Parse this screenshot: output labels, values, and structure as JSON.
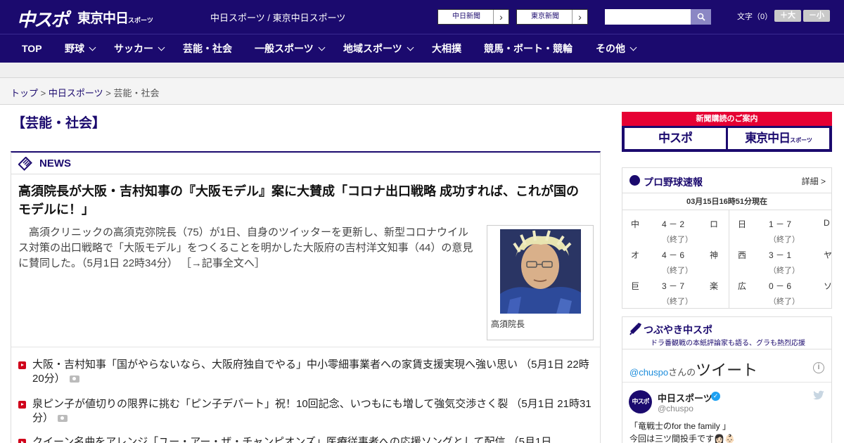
{
  "header": {
    "logo_chuspo": "中スポ",
    "logo_tokyo": "東京中日",
    "logo_tokyo_small": "スポーツ",
    "site_title": "中日スポーツ / 東京中日スポーツ",
    "paper_buttons": [
      "中日新聞",
      "東京新聞"
    ],
    "search": {
      "value": "",
      "placeholder": ""
    },
    "font_label": "文字（0）",
    "font_larger": "＋大",
    "font_smaller": "－小"
  },
  "nav": {
    "items": [
      {
        "label": "TOP",
        "has_menu": false
      },
      {
        "label": "野球",
        "has_menu": true
      },
      {
        "label": "サッカー",
        "has_menu": true
      },
      {
        "label": "芸能・社会",
        "has_menu": false
      },
      {
        "label": "一般スポーツ",
        "has_menu": true
      },
      {
        "label": "地域スポーツ",
        "has_menu": true
      },
      {
        "label": "大相撲",
        "has_menu": false
      },
      {
        "label": "競馬・ボート・競輪",
        "has_menu": false
      },
      {
        "label": "その他",
        "has_menu": true
      }
    ]
  },
  "breadcrumb": {
    "items": [
      "トップ",
      "中日スポーツ",
      "芸能・社会"
    ],
    "separator": ">"
  },
  "page_title": "【芸能・社会】",
  "news": {
    "section_label": "NEWS",
    "headline": "高須院長が大阪・吉村知事の『大阪モデル』案に大賛成「コロナ出口戦略 成功すれば、これが国のモデルに！」",
    "lead": "高須クリニックの高須克弥院長（75）が1日、自身のツイッターを更新し、新型コロナウイルス対策の出口戦略で「大阪モデル」をつくることを明かした大阪府の吉村洋文知事（44）の意見に賛同した。（5月1日 22時34分）",
    "more_link": "［→記事全文へ］",
    "photo_caption": "高須院長",
    "items": [
      "大阪・吉村知事「国がやらないなら、大阪府独自でやる」中小零細事業者への家賃支援実現へ強い思い （5月1日 22時20分）",
      "泉ピン子が値切りの限界に挑む「ピン子デパート」祝！10回記念、いつもにも増して強気交渉さく裂 （5月1日 21時31分）",
      "クイーン名曲をアレンジ「ユー・アー・ザ・チャンピオンズ」医療従事者への応援ソングとして配信 （5月1日"
    ]
  },
  "subscription": {
    "header": "新聞購読のご案内",
    "buttons": [
      "中スポ",
      "東京中日"
    ],
    "tokyo_small": "スポーツ"
  },
  "baseball": {
    "title": "プロ野球速報",
    "details_link": "詳細 >",
    "timestamp": "03月15日16時51分現在",
    "games": [
      {
        "home": "中",
        "score": "4 － 2",
        "away": "ロ",
        "status": "（終了）"
      },
      {
        "home": "オ",
        "score": "4 － 6",
        "away": "神",
        "status": "（終了）"
      },
      {
        "home": "巨",
        "score": "3 － 7",
        "away": "楽",
        "status": "（終了）"
      },
      {
        "home": "日",
        "score": "1 － 7",
        "away": "D",
        "status": "（終了）"
      },
      {
        "home": "西",
        "score": "3 － 1",
        "away": "ヤ",
        "status": "（終了）"
      },
      {
        "home": "広",
        "score": "0 － 6",
        "away": "ソ",
        "status": "（終了）"
      }
    ]
  },
  "tweets": {
    "title": "つぶやき中スポ",
    "subtitle": "ドラ番観戦の本紙評論家も語る、グラも熱烈応援",
    "account_link": "@chuspo",
    "account_suffix": "さんの",
    "heading": "ツイート",
    "avatar_text": "中スポ",
    "name": "中日スポーツ",
    "handle": "@chuspo",
    "text_line1": "「竜戦士のfor the family 」",
    "text_line2": "今回は三ツ間投手です👩🏻👶🏻"
  },
  "colors": {
    "brand_navy": "#1b0a6e",
    "accent_red": "#e60033",
    "twitter_blue": "#1da1f2"
  },
  "icons": [
    "search-icon",
    "chevron-right-icon",
    "chevron-down-icon",
    "news-icon",
    "baseball-icon",
    "megaphone-icon",
    "info-icon",
    "verified-icon",
    "twitter-bird-icon",
    "camera-icon",
    "bullet-icon"
  ]
}
